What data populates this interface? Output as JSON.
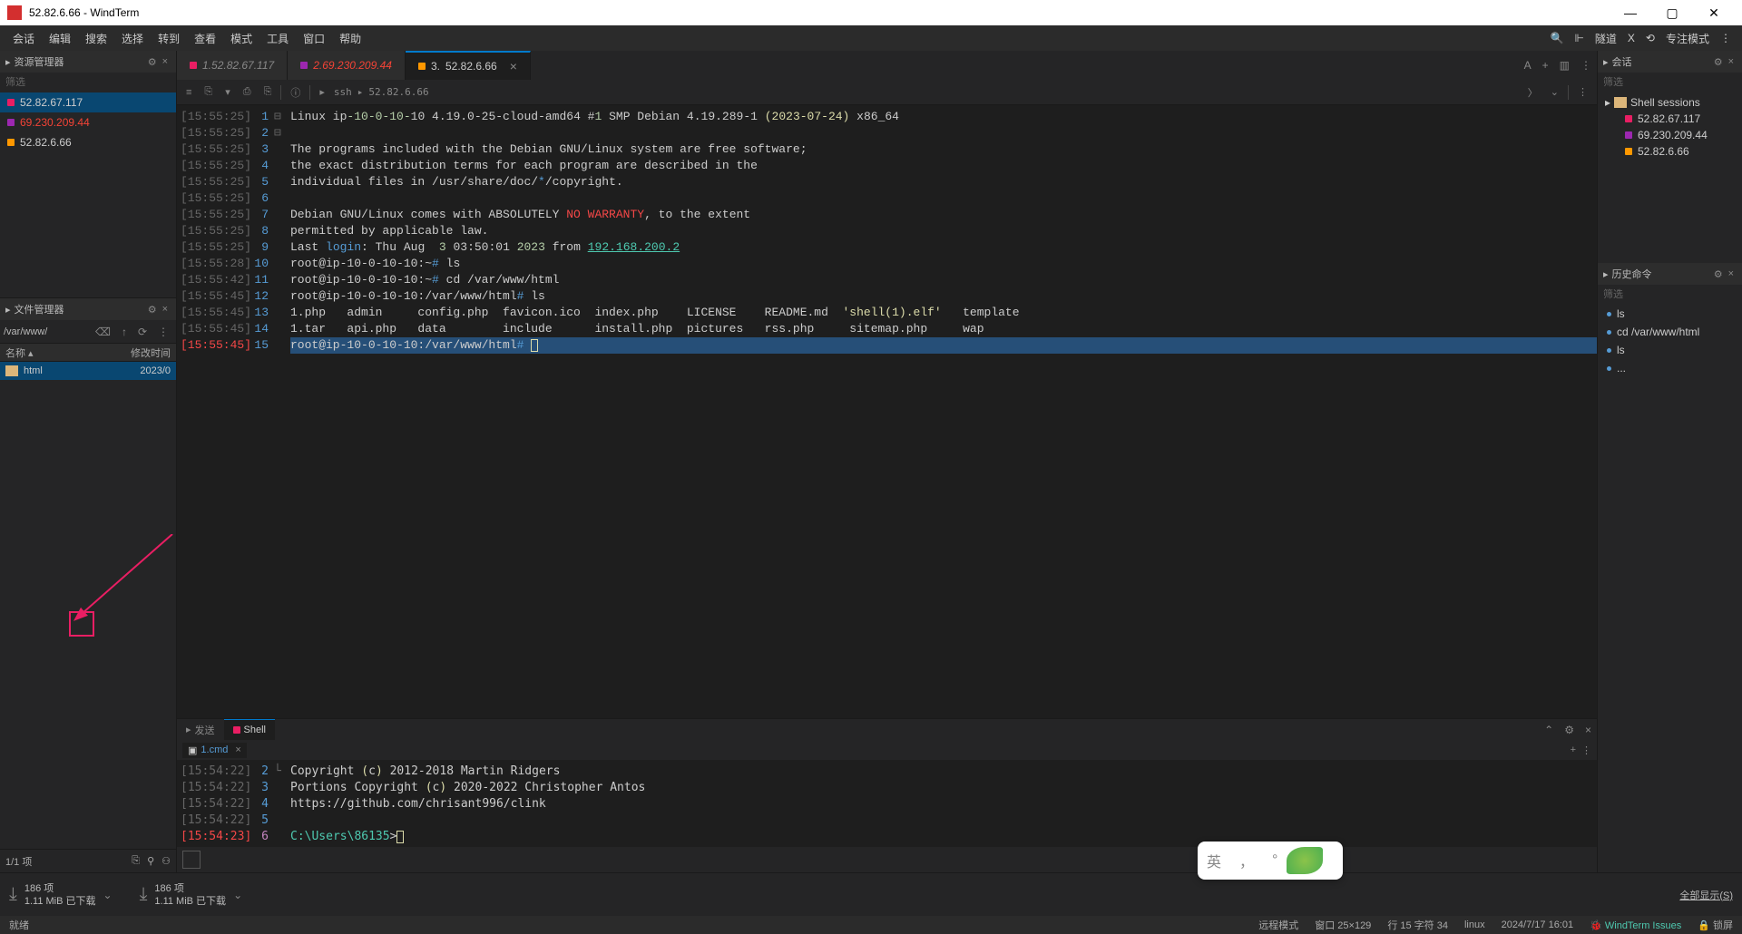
{
  "window": {
    "title": "52.82.6.66 - WindTerm"
  },
  "menu": [
    "会话",
    "编辑",
    "搜索",
    "选择",
    "转到",
    "查看",
    "模式",
    "工具",
    "窗口",
    "帮助"
  ],
  "menu_right": {
    "tunnel": "隧道",
    "x": "X",
    "focus": "专注模式 "
  },
  "explorer": {
    "title": "资源管理器",
    "filter": "筛选",
    "items": [
      {
        "color": "pink",
        "ip": "52.82.67.117"
      },
      {
        "color": "purple",
        "ip": "69.230.209.44",
        "red": true
      },
      {
        "color": "orange",
        "ip": "52.82.6.66"
      }
    ]
  },
  "filemgr": {
    "title": "文件管理器",
    "path": "/var/www/",
    "col_name": "名称",
    "col_mtime": "修改时间",
    "rows": [
      {
        "name": "html",
        "mtime": "2023/0"
      }
    ],
    "status": "1/1 项"
  },
  "tabs": [
    {
      "color": "pink",
      "prefix": "1.",
      "label": "52.82.67.117",
      "active": false
    },
    {
      "color": "purple",
      "prefix": "2.",
      "label": "69.230.209.44",
      "red": true,
      "active": false
    },
    {
      "color": "orange",
      "prefix": "3.",
      "label": "52.82.6.66",
      "active": true
    }
  ],
  "breadcrumb": {
    "p1": "ssh",
    "p2": "52.82.6.66"
  },
  "term": {
    "ts": [
      "[15:55:25]",
      "[15:55:25]",
      "[15:55:25]",
      "[15:55:25]",
      "[15:55:25]",
      "[15:55:25]",
      "[15:55:25]",
      "[15:55:25]",
      "[15:55:25]",
      "[15:55:28]",
      "[15:55:42]",
      "[15:55:45]",
      "[15:55:45]",
      "[15:55:45]",
      "[15:55:45]"
    ],
    "ln": [
      "1",
      "2",
      "3",
      "4",
      "5",
      "6",
      "7",
      "8",
      "9",
      "10",
      "11",
      "12",
      "13",
      "14",
      "15"
    ],
    "body": {
      "l1a": "Linux ip",
      "l1b": "-10-0-10-",
      "l1c": "10 4.19.0-25-cloud-amd64 #",
      "l1d": "1",
      "l1e": " SMP Debian 4.19.289-1 ",
      "l1f": "(2023-07-24)",
      "l1g": " x86_64",
      "l3": "The programs included with the Debian GNU/Linux system are free software;",
      "l4": "the exact distribution terms for each program are described in the",
      "l5a": "individual files in /usr/share/doc/",
      "l5b": "*",
      "l5c": "/copyright.",
      "l7a": "Debian GNU/Linux comes with ABSOLUTELY ",
      "l7b": "NO WARRANTY",
      "l7c": ", to the extent",
      "l8": "permitted by applicable law.",
      "l9a": "Last ",
      "l9b": "login",
      "l9c": ": Thu Aug  ",
      "l9d": "3",
      "l9e": " 03:50:01 ",
      "l9f": "2023",
      "l9g": " from ",
      "l9h": "192.168.200.2",
      "p1": "root@ip-10-0-10-10:~",
      "ph": "#",
      "c1": " ls",
      "p2": "root@ip-10-0-10-10:~",
      "c2": " cd /var/www/html",
      "p3": "root@ip-10-0-10-10:/var/www/html",
      "c3": " ls",
      "f1": "1.php   admin     config.php  favicon.ico  index.php    LICENSE    README.md  ",
      "f1b": "'shell(1).elf'",
      "f1c": "   template",
      "f2": "1.tar   api.php   data        include      install.php  pictures   rss.php     sitemap.php     wap",
      "p4": "root@ip-10-0-10-10:/var/www/html"
    }
  },
  "bottom": {
    "send": "发送",
    "shell": "Shell",
    "file": "1.cmd"
  },
  "shell": {
    "ts": [
      "[15:54:22]",
      "[15:54:22]",
      "[15:54:22]",
      "[15:54:22]",
      "[15:54:23]"
    ],
    "ln": [
      "2",
      "3",
      "4",
      "5",
      "6"
    ],
    "l1a": "Copyright ",
    "l1b": "(",
    "l1c": "c",
    "l1d": ")",
    "l1e": " 2012-2018 Martin Ridgers",
    "l2a": "Portions Copyright ",
    "l2b": "(",
    "l2c": "c",
    "l2d": ")",
    "l2e": " 2020-2022 Christopher Antos",
    "l3": "https://github.com/chrisant996/clink",
    "l5a": "C:\\Users\\86135",
    "l5b": ">"
  },
  "sessions": {
    "title": "会话",
    "filter": "筛选",
    "group": "Shell sessions",
    "items": [
      {
        "color": "pink",
        "ip": "52.82.67.117"
      },
      {
        "color": "purple",
        "ip": "69.230.209.44"
      },
      {
        "color": "orange",
        "ip": "52.82.6.66"
      }
    ]
  },
  "history": {
    "title": "历史命令",
    "filter": "筛选",
    "items": [
      "ls",
      "cd /var/www/html",
      "ls",
      "..."
    ]
  },
  "download": {
    "count": "186 项",
    "size": "1.11 MiB 已下载",
    "showall": "全部显示(S)"
  },
  "status": {
    "ready": "就绪",
    "remote": "远程模式",
    "win": "窗口 25×129",
    "pos": "行 15 字符 34",
    "os": "linux",
    "date": "2024/7/17 16:01",
    "issues": "WindTerm Issues",
    "lock": "锁屏"
  },
  "ime": {
    "ch": "英",
    "comma": "，",
    "dot": "°"
  }
}
